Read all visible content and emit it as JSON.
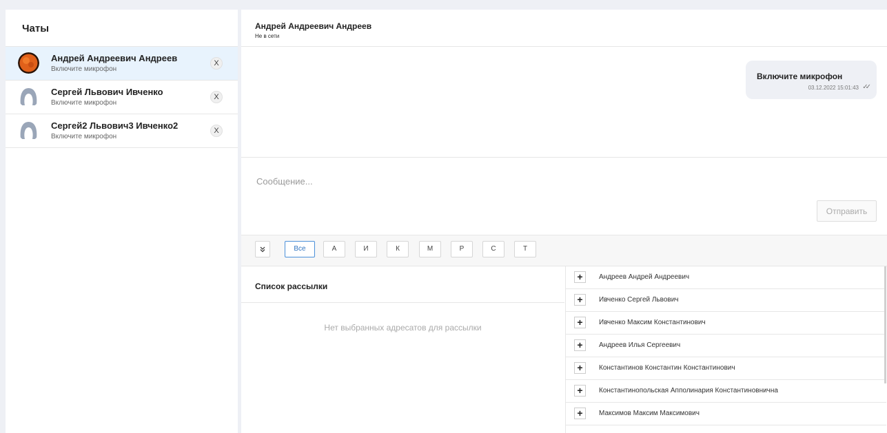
{
  "sidebar": {
    "title": "Чаты",
    "chats": [
      {
        "name": "Андрей Андреевич Андреев",
        "preview": "Включите микрофон",
        "close": "X",
        "avatar": "photo-avatar"
      },
      {
        "name": "Сергей Львович Ивченко",
        "preview": "Включите микрофон",
        "close": "X",
        "avatar": "user-placeholder-icon"
      },
      {
        "name": "Сергей2 Львович3 Ивченко2",
        "preview": "Включите микрофон",
        "close": "X",
        "avatar": "user-placeholder-icon"
      }
    ]
  },
  "conversation": {
    "name": "Андрей Андреевич Андреев",
    "status": "Не в сети",
    "messages": [
      {
        "text": "Включите микрофон",
        "time": "03.12.2022 15:01:43",
        "status_icon": "double-check-icon"
      }
    ]
  },
  "compose": {
    "placeholder": "Сообщение...",
    "send_label": "Отправить"
  },
  "filters": {
    "collapse_icon": "double-chevron-down-icon",
    "letters": [
      "Все",
      "А",
      "И",
      "К",
      "М",
      "Р",
      "С",
      "Т"
    ],
    "active": "Все"
  },
  "mailing": {
    "title": "Список рассылки",
    "empty": "Нет выбранных адресатов для рассылки"
  },
  "contacts": [
    {
      "name": "Андреев Андрей Андреевич",
      "add": "+"
    },
    {
      "name": "Ивченко Сергей Львович",
      "add": "+"
    },
    {
      "name": "Ивченко Максим Константинович",
      "add": "+"
    },
    {
      "name": "Андреев Илья Сергеевич",
      "add": "+"
    },
    {
      "name": "Константинов Константин Константинович",
      "add": "+"
    },
    {
      "name": "Константинопольская Апполинария Константиновнична",
      "add": "+"
    },
    {
      "name": "Максимов Максим Максимович",
      "add": "+"
    }
  ],
  "colors": {
    "accent": "#2f74c0",
    "active_chat_bg": "#e8f3fd",
    "page_bg": "#eef0f5"
  }
}
